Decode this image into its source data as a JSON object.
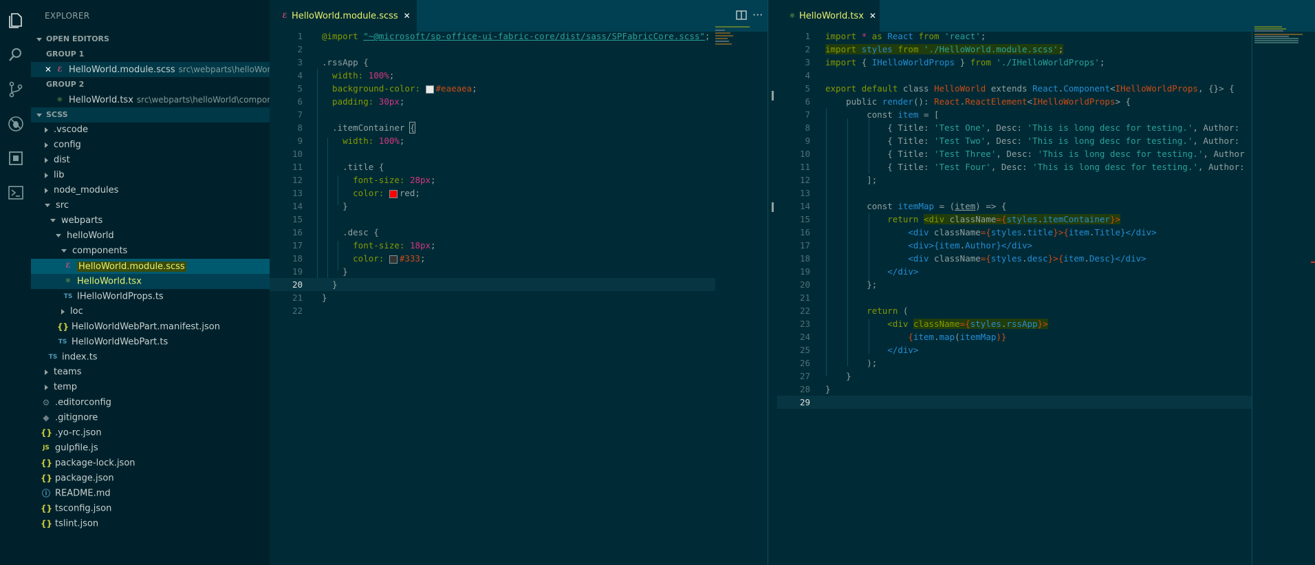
{
  "activity_bar": {
    "icons": [
      "explorer-icon",
      "search-icon",
      "source-control-icon",
      "debug-icon",
      "extensions-icon",
      "terminal-icon"
    ]
  },
  "sidebar": {
    "title": "EXPLORER",
    "open_editors": {
      "header": "OPEN EDITORS",
      "groups": [
        {
          "label": "GROUP 1",
          "items": [
            {
              "name": "HelloWorld.module.scss",
              "path": "src\\webparts\\helloWorld\\c..."
            }
          ]
        },
        {
          "label": "GROUP 2",
          "items": [
            {
              "name": "HelloWorld.tsx",
              "path": "src\\webparts\\helloWorld\\components"
            }
          ]
        }
      ]
    },
    "project": {
      "header": "SCSS",
      "tree": [
        ".vscode",
        "config",
        "dist",
        "lib",
        "node_modules",
        "src",
        "webparts",
        "helloWorld",
        "components",
        "HelloWorld.module.scss",
        "HelloWorld.tsx",
        "IHelloWorldProps.ts",
        "loc",
        "HelloWorldWebPart.manifest.json",
        "HelloWorldWebPart.ts",
        "index.ts",
        "teams",
        "temp",
        ".editorconfig",
        ".gitignore",
        ".yo-rc.json",
        "gulpfile.js",
        "package-lock.json",
        "package.json",
        "README.md",
        "tsconfig.json",
        "tslint.json"
      ],
      "icon_labels": {
        "ts": "TS",
        "js": "JS",
        "json": "{}"
      }
    }
  },
  "editor_left": {
    "tab": "HelloWorld.module.scss",
    "line_numbers": [
      "1",
      "2",
      "3",
      "4",
      "5",
      "6",
      "7",
      "8",
      "9",
      "10",
      "11",
      "12",
      "13",
      "14",
      "15",
      "16",
      "17",
      "18",
      "19",
      "20",
      "21",
      "22"
    ],
    "lines": {
      "l1_a": "@import ",
      "l1_b": "\"~@microsoft/sp-office-ui-fabric-core/dist/sass/SPFabricCore.scss\"",
      "l1_c": ";",
      "l3": ".rssApp {",
      "l4_a": "  width: ",
      "l4_b": "100%",
      "l4_c": ";",
      "l5_a": "  background-color: ",
      "l5_b": "#eaeaea",
      "l5_c": ";",
      "l6_a": "  padding: ",
      "l6_b": "30px",
      "l6_c": ";",
      "l8_a": "  .itemContainer ",
      "l8_b": "{",
      "l9_a": "    width: ",
      "l9_b": "100%",
      "l9_c": ";",
      "l11": "    .title {",
      "l12_a": "      font-size: ",
      "l12_b": "28px",
      "l12_c": ";",
      "l13_a": "      color: ",
      "l13_b": "red",
      "l13_c": ";",
      "l14": "    }",
      "l16": "    .desc {",
      "l17_a": "      font-size: ",
      "l17_b": "18px",
      "l17_c": ";",
      "l18_a": "      color: ",
      "l18_b": "#333",
      "l18_c": ";",
      "l19": "    }",
      "l20": "  }",
      "l21": "}"
    },
    "colors": {
      "swatch_eaeaea": "#eaeaea",
      "swatch_red": "#ff0000",
      "swatch_333": "#333333"
    }
  },
  "editor_right": {
    "tab": "HelloWorld.tsx",
    "line_numbers": [
      "1",
      "2",
      "3",
      "4",
      "5",
      "6",
      "7",
      "8",
      "9",
      "10",
      "11",
      "12",
      "13",
      "14",
      "15",
      "16",
      "17",
      "18",
      "19",
      "20",
      "21",
      "22",
      "23",
      "24",
      "25",
      "26",
      "27",
      "28",
      "29"
    ],
    "lines": {
      "r1_a": "import ",
      "r1_b": "* ",
      "r1_c": "as ",
      "r1_d": "React ",
      "r1_e": "from ",
      "r1_f": "'react'",
      "r1_g": ";",
      "r2_a": "import ",
      "r2_b": "styles ",
      "r2_c": "from ",
      "r2_d": "'./HelloWorld.module.scss'",
      "r2_e": ";",
      "r3_a": "import ",
      "r3_b": "{ ",
      "r3_c": "IHelloWorldProps",
      "r3_d": " } ",
      "r3_e": "from ",
      "r3_f": "'./IHelloWorldProps'",
      "r3_g": ";",
      "r5_a": "export ",
      "r5_b": "default ",
      "r5_c": "class ",
      "r5_d": "HelloWorld ",
      "r5_e": "extends ",
      "r5_f": "React",
      "r5_g": ".",
      "r5_h": "Component",
      "r5_i": "<",
      "r5_j": "IHelloWorldProps",
      "r5_k": ", {}> {",
      "r6_a": "    public ",
      "r6_b": "render",
      "r6_c": "(): ",
      "r6_d": "React",
      "r6_e": ".",
      "r6_f": "ReactElement",
      "r6_g": "<",
      "r6_h": "IHelloWorldProps",
      "r6_i": "> {",
      "r7_a": "        const ",
      "r7_b": "item",
      "r7_c": " = [",
      "r8_a": "            { Title: ",
      "r8_b": "'Test One'",
      "r8_c": ", Desc: ",
      "r8_d": "'This is long desc for testing.'",
      "r8_e": ", Author:",
      "r9_a": "            { Title: ",
      "r9_b": "'Test Two'",
      "r9_c": ", Desc: ",
      "r9_d": "'This is long desc for testing.'",
      "r9_e": ", Author:",
      "r10_a": "            { Title: ",
      "r10_b": "'Test Three'",
      "r10_c": ", Desc: ",
      "r10_d": "'This is long desc for testing.'",
      "r10_e": ", Author",
      "r11_a": "            { Title: ",
      "r11_b": "'Test Four'",
      "r11_c": ", Desc: ",
      "r11_d": "'This is long desc for testing.'",
      "r11_e": ", Author:",
      "r12": "        ];",
      "r14_a": "        const ",
      "r14_b": "itemMap",
      "r14_c": " = (",
      "r14_d": "item",
      "r14_e": ") => {",
      "r15_a": "            return ",
      "r15_b": "<div ",
      "r15_c": "className",
      "r15_d": "={",
      "r15_e": "styles",
      "r15_f": ".",
      "r15_g": "itemContainer",
      "r15_h": "}>",
      "r16_a": "                <div ",
      "r16_b": "className",
      "r16_c": "={",
      "r16_d": "styles",
      "r16_e": ".",
      "r16_f": "title",
      "r16_g": "}>{",
      "r16_h": "item",
      "r16_i": ".",
      "r16_j": "Title",
      "r16_k": "}</div>",
      "r17_a": "                <div>{",
      "r17_b": "item",
      "r17_c": ".",
      "r17_d": "Author",
      "r17_e": "}</div>",
      "r18_a": "                <div ",
      "r18_b": "className",
      "r18_c": "={",
      "r18_d": "styles",
      "r18_e": ".",
      "r18_f": "desc",
      "r18_g": "}>{",
      "r18_h": "item",
      "r18_i": ".",
      "r18_j": "Desc",
      "r18_k": "}</div>",
      "r19": "            </div>",
      "r20": "        };",
      "r22_a": "        return ",
      "r22_b": "(",
      "r23_a": "            <div ",
      "r23_b": "className",
      "r23_c": "={",
      "r23_d": "styles",
      "r23_e": ".",
      "r23_f": "rssApp",
      "r23_g": "}>",
      "r24_a": "                {",
      "r24_b": "item",
      "r24_c": ".",
      "r24_d": "map",
      "r24_e": "(",
      "r24_f": "itemMap",
      "r24_g": ")}",
      "r25": "            </div>",
      "r26": "        );",
      "r27": "    }",
      "r28": "}"
    }
  }
}
